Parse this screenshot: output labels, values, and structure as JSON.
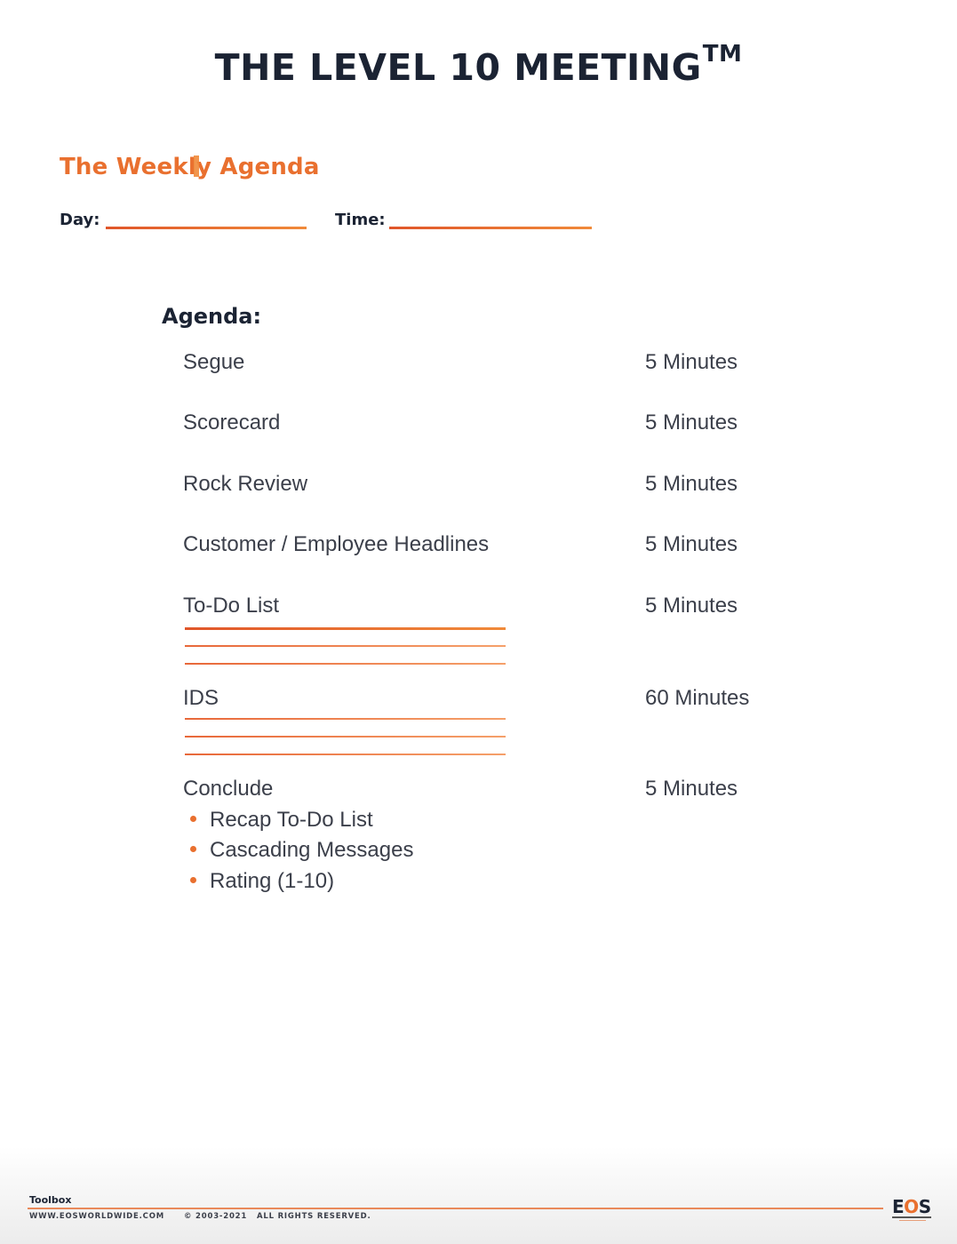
{
  "document": {
    "title": "THE LEVEL 10 MEETING",
    "trademark": "TM",
    "subtitle_before_cursor": "The Weekl",
    "subtitle_after_cursor": "y Agenda",
    "fields": {
      "day_label": "Day:",
      "day_value": "",
      "time_label": "Time:",
      "time_value": ""
    },
    "agenda": {
      "heading": "Agenda:",
      "items": [
        {
          "label": "Segue",
          "time": "5 Minutes"
        },
        {
          "label": "Scorecard",
          "time": "5 Minutes"
        },
        {
          "label": "Rock Review",
          "time": "5 Minutes"
        },
        {
          "label": "Customer / Employee Headlines",
          "time": "5 Minutes"
        },
        {
          "label": "To-Do List",
          "time": "5 Minutes"
        },
        {
          "label": "IDS",
          "time": "60 Minutes"
        },
        {
          "label": "Conclude",
          "time": "5 Minutes"
        }
      ],
      "conclude_bullets": [
        "Recap To-Do List",
        "Cascading Messages",
        "Rating (1-10)"
      ]
    }
  },
  "footer": {
    "label": "Toolbox",
    "website": "WWW.EOSWORLDWIDE.COM",
    "copyright": "© 2003-2021",
    "rights": "ALL RIGHTS RESERVED.",
    "logo_left": "E",
    "logo_mid": "O",
    "logo_right": "S"
  },
  "colors": {
    "accent": "#e9702f",
    "heading": "#1b2333",
    "body": "#3b3f4a"
  }
}
